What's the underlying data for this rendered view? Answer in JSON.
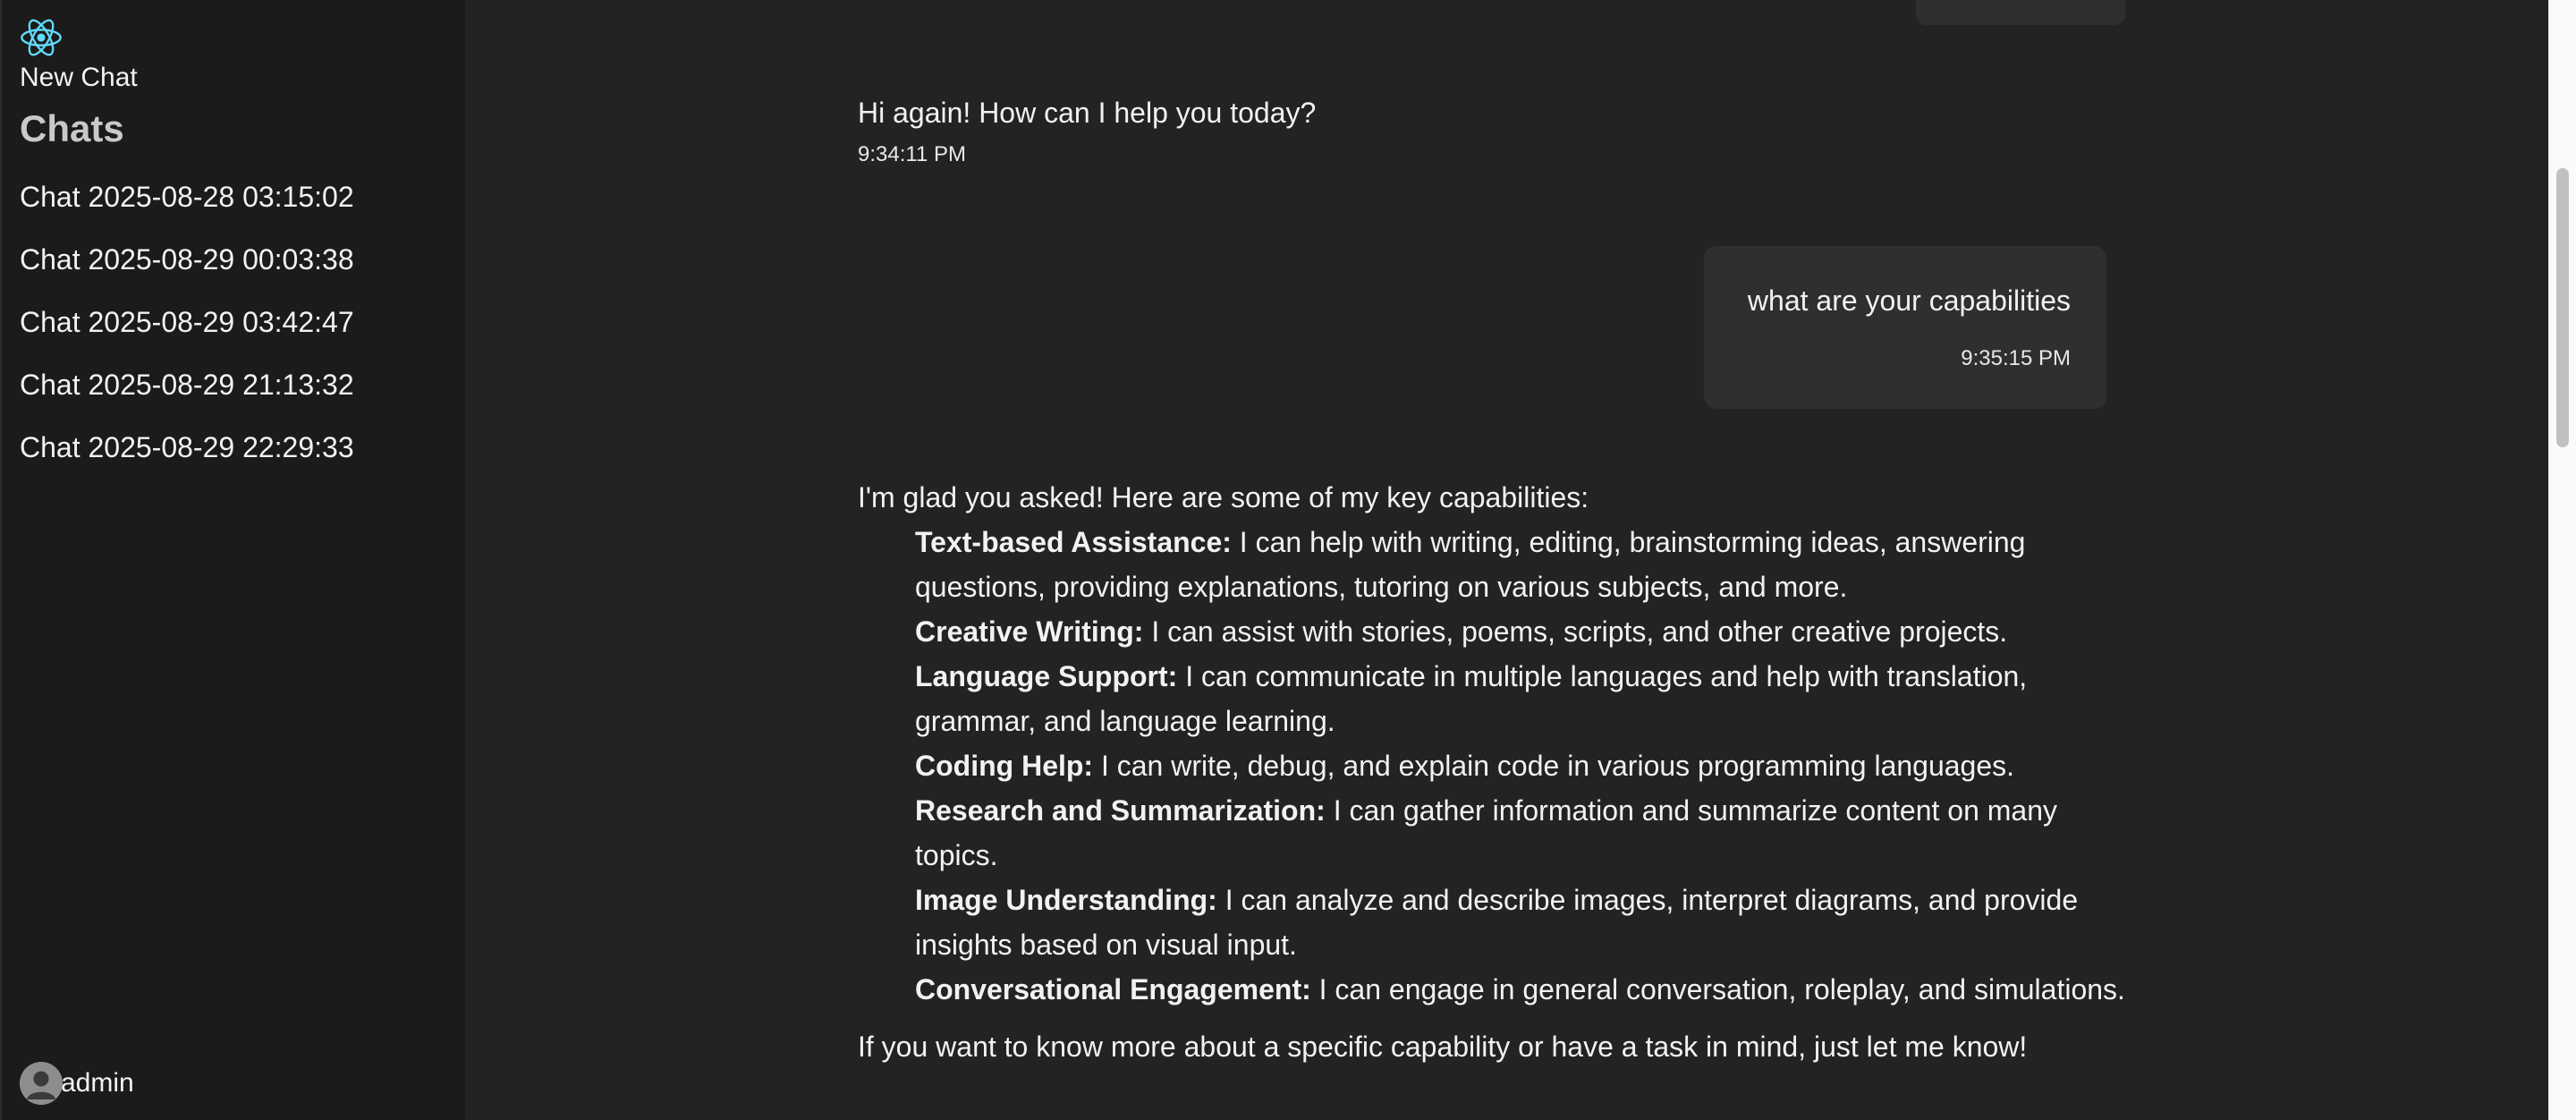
{
  "sidebar": {
    "logo_icon": "react-atom-icon",
    "new_chat_label": "New Chat",
    "chats_heading": "Chats",
    "chats": [
      {
        "label": "Chat 2025-08-28 03:15:02"
      },
      {
        "label": "Chat 2025-08-29 00:03:38"
      },
      {
        "label": "Chat 2025-08-29 03:42:47"
      },
      {
        "label": "Chat 2025-08-29 21:13:32"
      },
      {
        "label": "Chat 2025-08-29 22:29:33"
      }
    ],
    "user": {
      "avatar_icon": "user-avatar-icon",
      "name": "admin"
    }
  },
  "conversation": {
    "greeting": {
      "text": "Hi again! How can I help you today?",
      "time": "9:34:11 PM"
    },
    "user_message": {
      "text": "what are your capabilities",
      "time": "9:35:15 PM"
    },
    "answer": {
      "intro": "I'm glad you asked! Here are some of my key capabilities:",
      "capabilities": [
        {
          "title": "Text-based Assistance:",
          "text": " I can help with writing, editing, brainstorming ideas, answering questions, providing explanations, tutoring on various subjects, and more."
        },
        {
          "title": "Creative Writing:",
          "text": " I can assist with stories, poems, scripts, and other creative projects."
        },
        {
          "title": "Language Support:",
          "text": " I can communicate in multiple languages and help with translation, grammar, and language learning."
        },
        {
          "title": "Coding Help:",
          "text": " I can write, debug, and explain code in various programming languages."
        },
        {
          "title": "Research and Summarization:",
          "text": " I can gather information and summarize content on many topics."
        },
        {
          "title": "Image Understanding:",
          "text": " I can analyze and describe images, interpret diagrams, and provide insights based on visual input."
        },
        {
          "title": "Conversational Engagement:",
          "text": " I can engage in general conversation, roleplay, and simulations."
        }
      ],
      "outro": "If you want to know more about a specific capability or have a task in mind, just let me know!"
    }
  },
  "colors": {
    "sidebar_bg": "#1b1b1b",
    "main_bg": "#232323",
    "bubble_bg": "#2f2f2f",
    "react_logo": "#61dafb"
  }
}
